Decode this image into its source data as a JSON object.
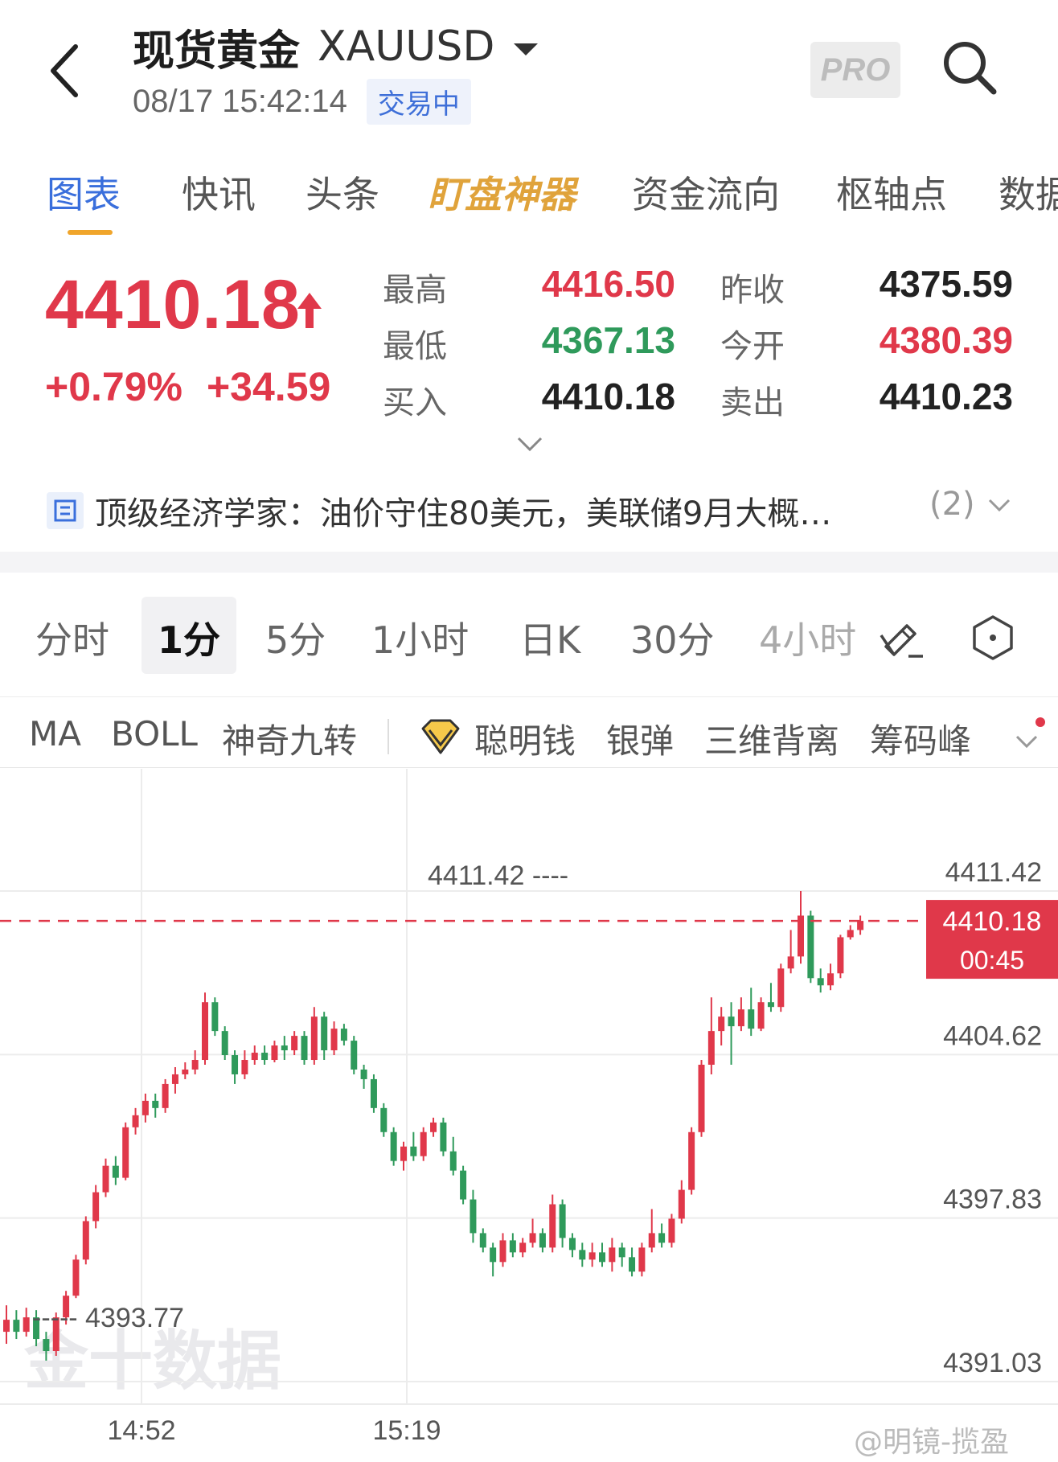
{
  "header": {
    "title": "现货黄金",
    "code": "XAUUSD",
    "timestamp": "08/17 15:42:14",
    "status": "交易中",
    "pro_label": "PRO"
  },
  "tabs": [
    {
      "label": "图表",
      "active": true
    },
    {
      "label": "快讯"
    },
    {
      "label": "头条"
    },
    {
      "label": "盯盘神器",
      "highlight": true
    },
    {
      "label": "资金流向"
    },
    {
      "label": "枢轴点"
    },
    {
      "label": "数据"
    }
  ],
  "quote": {
    "price": "4410.18",
    "change_pct": "+0.79%",
    "change_abs": "+34.59",
    "stats": [
      {
        "label": "最高",
        "value": "4416.50",
        "tone": "red"
      },
      {
        "label": "昨收",
        "value": "4375.59",
        "tone": "dark"
      },
      {
        "label": "最低",
        "value": "4367.13",
        "tone": "green"
      },
      {
        "label": "今开",
        "value": "4380.39",
        "tone": "red"
      },
      {
        "label": "买入",
        "value": "4410.18",
        "tone": "dark"
      },
      {
        "label": "卖出",
        "value": "4410.23",
        "tone": "dark"
      }
    ]
  },
  "news": {
    "text": "顶级经济学家：油价守住80美元，美联储9月大概…",
    "count": "(2)"
  },
  "periods": [
    {
      "label": "分时"
    },
    {
      "label": "1分",
      "active": true
    },
    {
      "label": "5分"
    },
    {
      "label": "1小时"
    },
    {
      "label": "日K"
    },
    {
      "label": "30分"
    },
    {
      "label": "4小时"
    }
  ],
  "indicators": [
    "MA",
    "BOLL",
    "神奇九转",
    "聪明钱",
    "银弹",
    "三维背离",
    "筹码峰"
  ],
  "colors": {
    "up": "#e0384a",
    "down": "#2f9a5b",
    "accent": "#3a6fdc",
    "gold": "#e0a33b"
  },
  "chart_data": {
    "type": "candlestick",
    "y_ticks": [
      "4411.42",
      "4404.62",
      "4397.83",
      "4391.03"
    ],
    "ylim": [
      4391.03,
      4411.42
    ],
    "x_ticks": [
      "14:52",
      "15:19"
    ],
    "current_price": "4410.18",
    "countdown": "00:45",
    "high_marker": "4411.42",
    "low_marker": "4393.77",
    "candles": [
      [
        4393.1,
        4393.6,
        4392.6,
        4394.2
      ],
      [
        4393.6,
        4393.1,
        4392.8,
        4394.0
      ],
      [
        4393.1,
        4393.7,
        4392.9,
        4394.1
      ],
      [
        4393.7,
        4392.8,
        4392.5,
        4394.0
      ],
      [
        4392.8,
        4392.3,
        4391.9,
        4393.1
      ],
      [
        4392.3,
        4393.7,
        4392.1,
        4393.9
      ],
      [
        4393.7,
        4394.6,
        4393.4,
        4394.8
      ],
      [
        4394.6,
        4396.1,
        4394.5,
        4396.3
      ],
      [
        4396.1,
        4397.7,
        4395.9,
        4397.9
      ],
      [
        4397.7,
        4398.9,
        4397.4,
        4399.2
      ],
      [
        4398.9,
        4400.0,
        4398.7,
        4400.3
      ],
      [
        4400.0,
        4399.5,
        4399.2,
        4400.4
      ],
      [
        4399.5,
        4401.6,
        4399.4,
        4401.8
      ],
      [
        4401.6,
        4402.1,
        4401.3,
        4402.4
      ],
      [
        4402.1,
        4402.7,
        4401.8,
        4403.0
      ],
      [
        4402.7,
        4402.4,
        4402.0,
        4403.0
      ],
      [
        4402.4,
        4403.4,
        4402.2,
        4403.6
      ],
      [
        4403.4,
        4403.8,
        4403.0,
        4404.1
      ],
      [
        4403.8,
        4404.0,
        4403.6,
        4404.3
      ],
      [
        4404.0,
        4404.4,
        4403.8,
        4404.8
      ],
      [
        4404.4,
        4406.8,
        4404.2,
        4407.2
      ],
      [
        4406.8,
        4405.6,
        4405.4,
        4407.0
      ],
      [
        4405.6,
        4404.6,
        4404.4,
        4405.8
      ],
      [
        4404.6,
        4403.8,
        4403.4,
        4404.8
      ],
      [
        4403.8,
        4404.4,
        4403.6,
        4404.8
      ],
      [
        4404.4,
        4404.7,
        4404.2,
        4405.0
      ],
      [
        4404.7,
        4404.4,
        4404.2,
        4405.0
      ],
      [
        4404.4,
        4405.0,
        4404.3,
        4405.2
      ],
      [
        4405.0,
        4404.8,
        4404.4,
        4405.4
      ],
      [
        4404.8,
        4405.4,
        4404.6,
        4405.6
      ],
      [
        4405.4,
        4404.4,
        4404.2,
        4405.6
      ],
      [
        4404.4,
        4406.2,
        4404.2,
        4406.6
      ],
      [
        4406.2,
        4404.8,
        4404.4,
        4406.4
      ],
      [
        4404.8,
        4405.7,
        4404.6,
        4406.0
      ],
      [
        4405.7,
        4405.2,
        4405.0,
        4405.9
      ],
      [
        4405.2,
        4404.0,
        4403.8,
        4405.4
      ],
      [
        4404.0,
        4403.6,
        4403.2,
        4404.2
      ],
      [
        4403.6,
        4402.4,
        4402.2,
        4403.8
      ],
      [
        4402.4,
        4401.4,
        4401.2,
        4402.6
      ],
      [
        4401.4,
        4400.2,
        4400.0,
        4401.6
      ],
      [
        4400.2,
        4400.8,
        4399.8,
        4401.0
      ],
      [
        4400.8,
        4400.4,
        4400.2,
        4401.4
      ],
      [
        4400.4,
        4401.4,
        4400.2,
        4401.6
      ],
      [
        4401.4,
        4401.8,
        4401.2,
        4402.0
      ],
      [
        4401.8,
        4400.6,
        4400.4,
        4402.0
      ],
      [
        4400.6,
        4399.8,
        4399.6,
        4401.2
      ],
      [
        4399.8,
        4398.6,
        4398.4,
        4400.0
      ],
      [
        4398.6,
        4397.2,
        4396.8,
        4399.0
      ],
      [
        4397.2,
        4396.6,
        4396.4,
        4397.4
      ],
      [
        4396.6,
        4396.0,
        4395.4,
        4396.8
      ],
      [
        4396.0,
        4396.9,
        4395.8,
        4397.2
      ],
      [
        4396.9,
        4396.4,
        4396.2,
        4397.2
      ],
      [
        4396.4,
        4396.8,
        4396.2,
        4397.0
      ],
      [
        4396.8,
        4397.2,
        4396.6,
        4397.8
      ],
      [
        4397.2,
        4396.6,
        4396.4,
        4397.4
      ],
      [
        4396.6,
        4398.4,
        4396.4,
        4398.8
      ],
      [
        4398.4,
        4397.0,
        4396.6,
        4398.6
      ],
      [
        4397.0,
        4396.5,
        4396.2,
        4397.2
      ],
      [
        4396.5,
        4396.1,
        4395.8,
        4396.8
      ],
      [
        4396.1,
        4396.4,
        4395.8,
        4396.8
      ],
      [
        4396.4,
        4396.0,
        4395.8,
        4396.8
      ],
      [
        4396.0,
        4396.6,
        4395.6,
        4397.0
      ],
      [
        4396.6,
        4396.2,
        4395.8,
        4396.8
      ],
      [
        4396.2,
        4395.6,
        4395.4,
        4396.6
      ],
      [
        4395.6,
        4396.6,
        4395.4,
        4396.8
      ],
      [
        4396.6,
        4397.2,
        4396.4,
        4398.2
      ],
      [
        4397.2,
        4396.8,
        4396.6,
        4397.6
      ],
      [
        4396.8,
        4397.8,
        4396.6,
        4398.0
      ],
      [
        4397.8,
        4399.0,
        4397.6,
        4399.4
      ],
      [
        4399.0,
        4401.4,
        4398.8,
        4401.6
      ],
      [
        4401.4,
        4404.2,
        4401.2,
        4404.4
      ],
      [
        4404.2,
        4405.6,
        4403.8,
        4407.0
      ],
      [
        4405.6,
        4406.2,
        4405.0,
        4406.6
      ],
      [
        4406.2,
        4405.8,
        4404.2,
        4406.8
      ],
      [
        4405.8,
        4406.5,
        4405.6,
        4407.0
      ],
      [
        4406.5,
        4405.7,
        4405.4,
        4407.4
      ],
      [
        4405.7,
        4406.8,
        4405.6,
        4407.0
      ],
      [
        4406.8,
        4406.6,
        4406.4,
        4407.6
      ],
      [
        4406.6,
        4408.2,
        4406.4,
        4408.4
      ],
      [
        4408.2,
        4408.7,
        4408.0,
        4409.8
      ],
      [
        4408.7,
        4410.4,
        4408.4,
        4411.42
      ],
      [
        4410.4,
        4407.8,
        4407.6,
        4410.6
      ],
      [
        4407.8,
        4407.5,
        4407.2,
        4408.2
      ],
      [
        4407.5,
        4408.0,
        4407.3,
        4408.4
      ],
      [
        4408.0,
        4409.5,
        4407.8,
        4409.6
      ],
      [
        4409.5,
        4409.8,
        4409.4,
        4410.0
      ],
      [
        4409.8,
        4410.18,
        4409.6,
        4410.4
      ]
    ]
  },
  "footer": {
    "watermark": "金十数据",
    "credit": "@明镜-揽盈"
  }
}
